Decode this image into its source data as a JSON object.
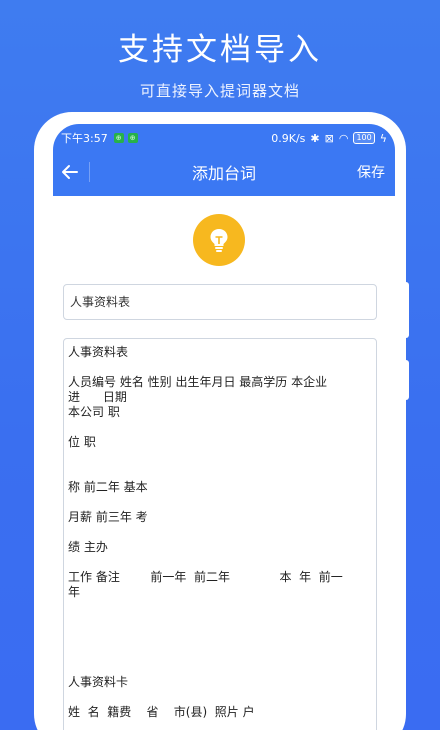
{
  "promo": {
    "title": "支持文档导入",
    "subtitle": "可直接导入提词器文档"
  },
  "status_bar": {
    "time": "下午3:57",
    "app_icons": [
      "⊕",
      "⊕"
    ],
    "network_speed": "0.9K/s",
    "bluetooth": "✱",
    "sim": "⊠",
    "wifi": "◠",
    "battery": "100",
    "bolt": "ϟ"
  },
  "nav": {
    "back_icon": "back-arrow-icon",
    "title": "添加台词",
    "save_label": "保存"
  },
  "editor": {
    "icon": "lightbulb-icon",
    "title_value": "人事资料表",
    "content_lines": [
      "人事资料表",
      "",
      "人员编号 姓名 性别 出生年月日 最高学历 本企业",
      "进      日期",
      "本公司 职",
      "",
      "位 职",
      "",
      "",
      "称 前二年 基本",
      "",
      "月薪 前三年 考",
      "",
      "绩 主办",
      "",
      "工作 备注        前一年  前二年             本  年  前一",
      "年",
      "",
      "",
      "",
      "",
      "",
      "人事资料卡",
      "",
      "姓  名  籍费    省    市(县)  照片 户"
    ]
  },
  "colors": {
    "background": "#3b78f3",
    "header": "#3b78f3",
    "bulb": "#f7b81f"
  }
}
